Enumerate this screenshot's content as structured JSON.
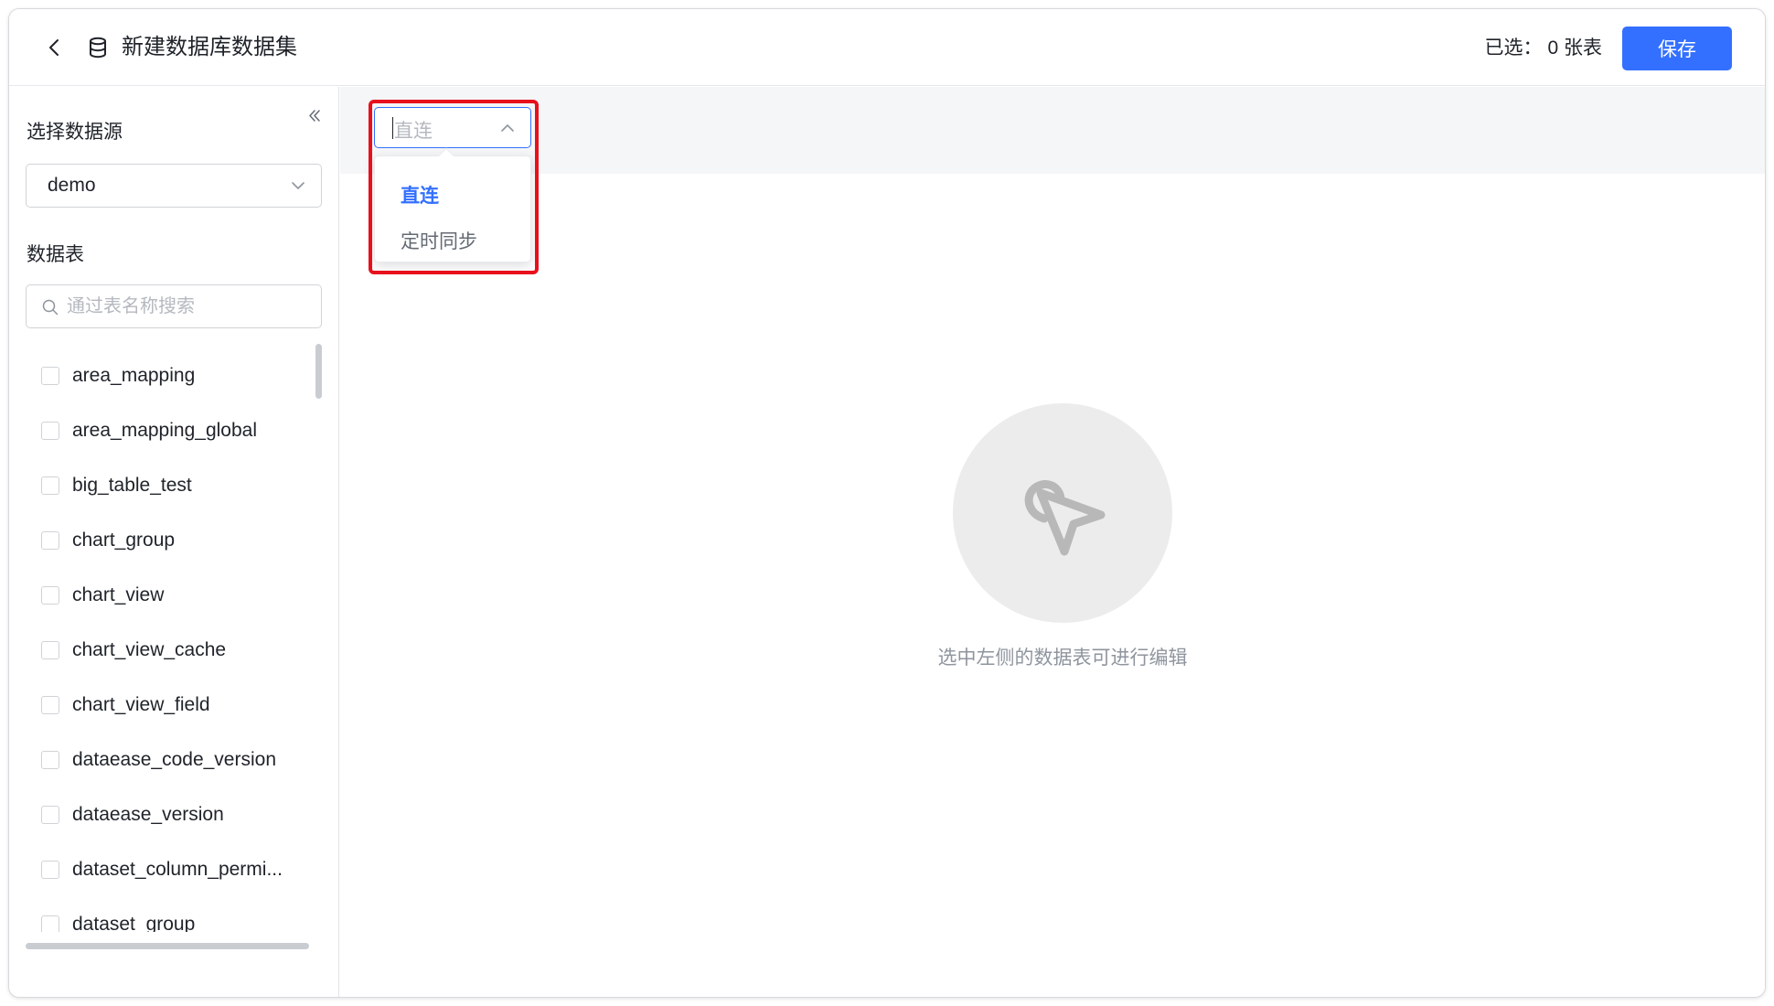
{
  "header": {
    "title": "新建数据库数据集",
    "selected_label": "已选：",
    "selected_count": "0 张表",
    "save_label": "保存",
    "back_icon": "chevron-left-icon",
    "db_icon": "database-icon"
  },
  "sidebar": {
    "datasource_label": "选择数据源",
    "datasource_value": "demo",
    "tables_label": "数据表",
    "search_placeholder": "通过表名称搜索",
    "tables": [
      "area_mapping",
      "area_mapping_global",
      "big_table_test",
      "chart_group",
      "chart_view",
      "chart_view_cache",
      "chart_view_field",
      "dataease_code_version",
      "dataease_version",
      "dataset_column_permi...",
      "dataset_group"
    ]
  },
  "main": {
    "mode_placeholder": "直连",
    "mode_options": [
      {
        "label": "直连",
        "active": true
      },
      {
        "label": "定时同步",
        "active": false
      }
    ],
    "empty_text": "选中左侧的数据表可进行编辑"
  },
  "colors": {
    "accent": "#3370ff",
    "highlight": "#e8101c",
    "band": "#f5f6f7"
  }
}
